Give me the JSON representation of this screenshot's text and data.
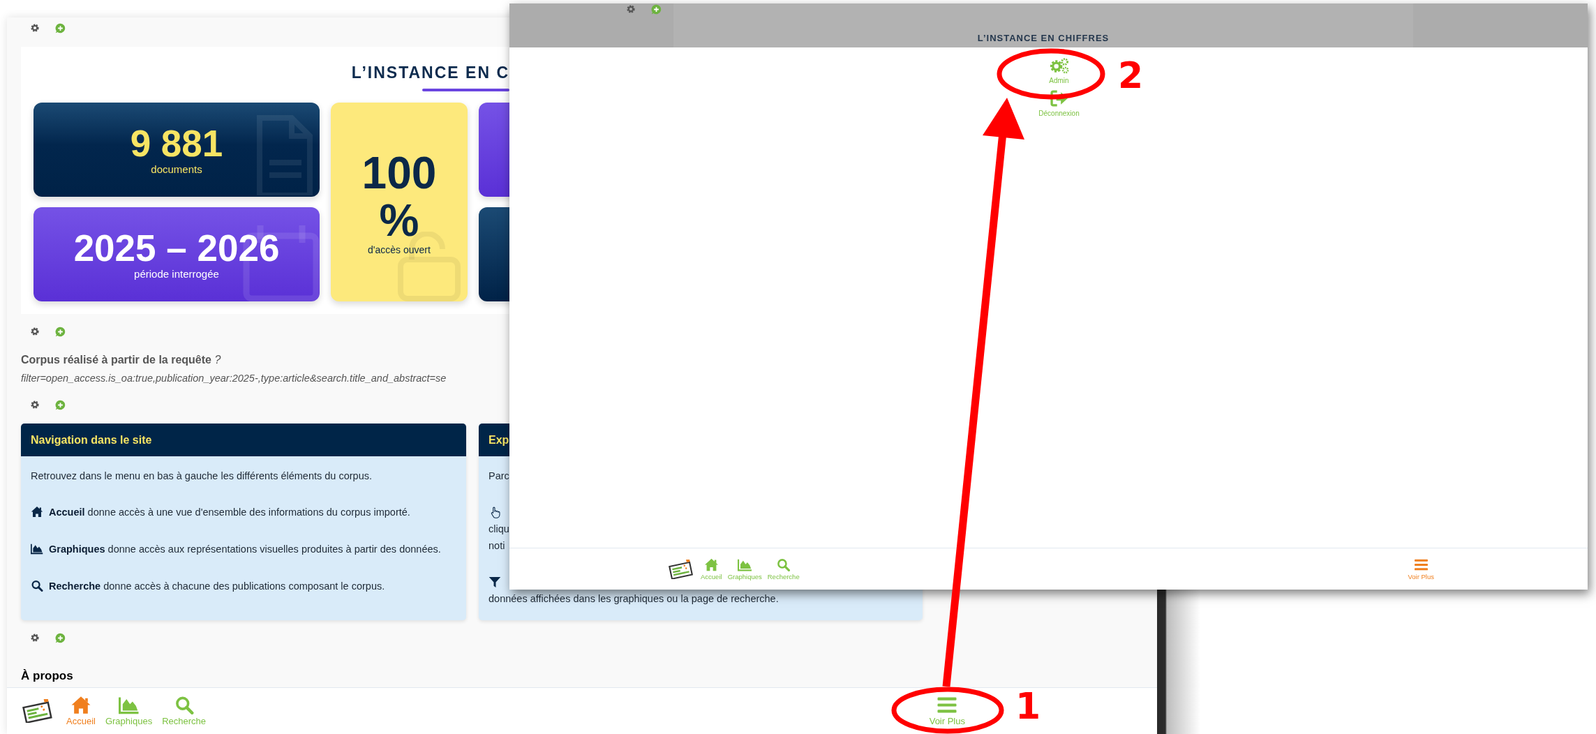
{
  "left_window": {
    "title": "L’INSTANCE EN C",
    "stats": [
      {
        "kind": "documents",
        "value": "9 881",
        "label": "documents"
      },
      {
        "kind": "period",
        "value": "2025 – 2026",
        "label": "période interrogée"
      },
      {
        "kind": "open_access",
        "value": "100 %",
        "label": "d'accès ouvert"
      },
      {
        "kind": "purple_partial"
      },
      {
        "kind": "dark_partial"
      }
    ],
    "corpus": {
      "label": "Corpus réalisé à partir de la requête",
      "help": "?",
      "query": "filter=open_access.is_oa:true,publication_year:2025-,type:article&search.title_and_abstract=se"
    },
    "panels": [
      {
        "title": "Navigation dans le site",
        "intro": "Retrouvez dans le menu en bas à gauche les différents éléments du corpus.",
        "items": [
          {
            "kind": "home",
            "text": "**Accueil** donne accès à une vue d'ensemble des informations du corpus importé."
          },
          {
            "kind": "chart",
            "text": "**Graphiques** donne accès aux représentations visuelles produites à partir des données."
          },
          {
            "kind": "search",
            "text": "**Recherche** donne accès à chacune des publications composant le corpus."
          }
        ]
      },
      {
        "title": "Exp",
        "intro": "Parc",
        "items": [
          {
            "kind": "pointer",
            "lines": [
              "cliqu",
              "noti"
            ]
          },
          {
            "kind": "filter",
            "lines": [
              "données affichées dans les graphiques ou la page de recherche."
            ]
          }
        ]
      }
    ],
    "section_heading": "À propos",
    "nav": {
      "items": [
        {
          "kind": "home",
          "label": "Accueil",
          "selected": true
        },
        {
          "kind": "chart",
          "label": "Graphiques",
          "selected": false
        },
        {
          "kind": "search",
          "label": "Recherche",
          "selected": false
        }
      ],
      "more": {
        "label": "Voir Plus",
        "selected": false
      }
    }
  },
  "overlay_window": {
    "title": "L’INSTANCE EN CHIFFRES",
    "menu": [
      {
        "kind": "gears",
        "label": "Admin"
      },
      {
        "kind": "sign_out",
        "label": "Déconnexion"
      }
    ],
    "nav": {
      "items": [
        {
          "kind": "home",
          "label": "Accueil",
          "selected": false
        },
        {
          "kind": "chart",
          "label": "Graphiques",
          "selected": false
        },
        {
          "kind": "search",
          "label": "Recherche",
          "selected": false
        }
      ],
      "more": {
        "label": "Voir Plus",
        "selected": true
      }
    }
  },
  "annotations": [
    {
      "label": "1"
    },
    {
      "label": "2"
    }
  ]
}
